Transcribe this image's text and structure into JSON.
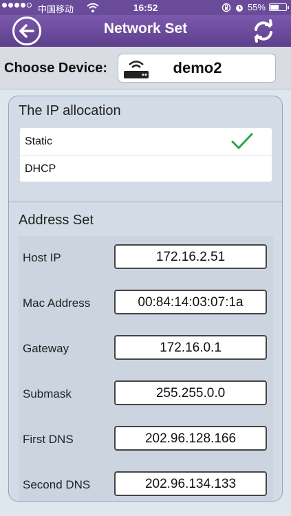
{
  "status_bar": {
    "carrier": "中国移动",
    "time": "16:52",
    "battery_percent": "55%",
    "battery_level": 0.55,
    "signal_bars": 4,
    "icons": [
      "wifi-icon",
      "orientation-lock-icon",
      "alarm-icon",
      "battery-icon"
    ]
  },
  "navbar": {
    "title": "Network Set",
    "back_icon": "back-arrow-icon",
    "refresh_icon": "refresh-icon"
  },
  "device": {
    "label": "Choose Device:",
    "name": "demo2",
    "icon": "router-icon"
  },
  "ip_allocation": {
    "title": "The IP allocation",
    "options": [
      {
        "label": "Static",
        "selected": true
      },
      {
        "label": "DHCP",
        "selected": false
      }
    ]
  },
  "address_set": {
    "title": "Address Set",
    "rows": [
      {
        "label": "Host IP",
        "value": "172.16.2.51"
      },
      {
        "label": "Mac Address",
        "value": "00:84:14:03:07:1a"
      },
      {
        "label": "Gateway",
        "value": "172.16.0.1"
      },
      {
        "label": "Submask",
        "value": "255.255.0.0"
      },
      {
        "label": "First DNS",
        "value": "202.96.128.166"
      },
      {
        "label": "Second DNS",
        "value": "202.96.134.133"
      }
    ]
  },
  "colors": {
    "nav_bar": "#6a4b9a",
    "check": "#22a845",
    "panel_border": "#8ea6c2"
  }
}
